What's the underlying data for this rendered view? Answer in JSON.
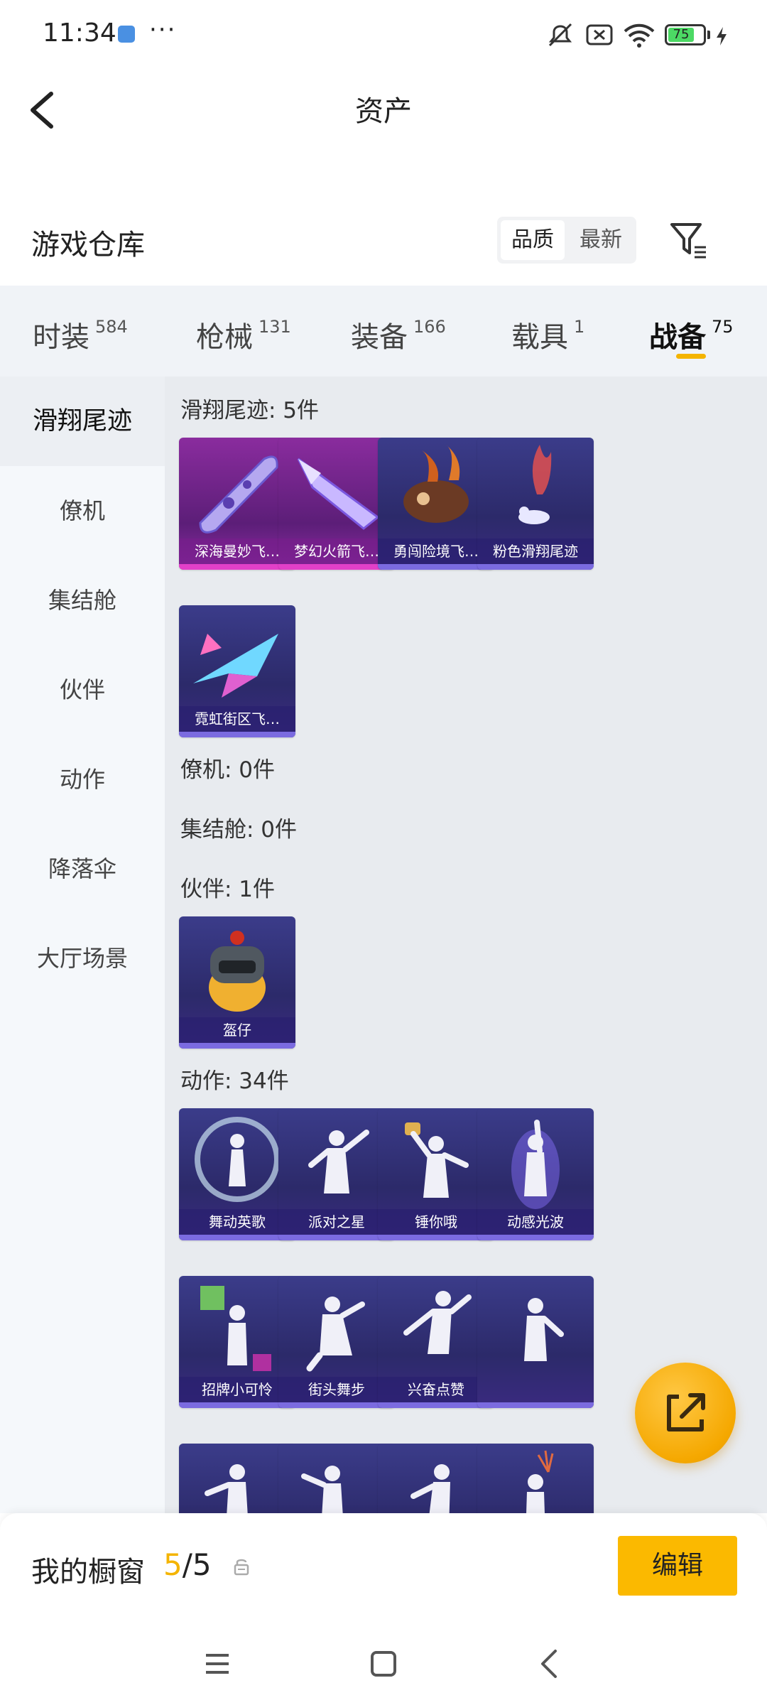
{
  "status_bar": {
    "time": "11:34",
    "dots": "···",
    "battery": "75",
    "icons": [
      "app-notification-icon",
      "mute-icon",
      "sim-off-icon",
      "wifi-icon",
      "battery-icon",
      "charging-icon"
    ]
  },
  "header": {
    "title": "资产"
  },
  "warehouse": {
    "title": "游戏仓库",
    "sort_quality": "品质",
    "sort_newest": "最新"
  },
  "tabs": [
    {
      "label": "时装",
      "count": "584"
    },
    {
      "label": "枪械",
      "count": "131"
    },
    {
      "label": "装备",
      "count": "166"
    },
    {
      "label": "载具",
      "count": "1"
    },
    {
      "label": "战备",
      "count": "75"
    }
  ],
  "sidebar": {
    "items": [
      "滑翔尾迹",
      "僚机",
      "集结舱",
      "伙伴",
      "动作",
      "降落伞",
      "大厅场景"
    ]
  },
  "groups": {
    "trail": {
      "header": "滑翔尾迹: 5件",
      "items": [
        "深海曼妙飞…",
        "梦幻火箭飞…",
        "勇闯险境飞…",
        "粉色滑翔尾迹",
        "霓虹街区飞…"
      ]
    },
    "wingman": {
      "header": "僚机: 0件"
    },
    "capsule": {
      "header": "集结舱: 0件"
    },
    "partner": {
      "header": "伙伴: 1件",
      "items": [
        "盔仔"
      ]
    },
    "emote": {
      "header": "动作: 34件",
      "items": [
        "舞动英歌",
        "派对之星",
        "锤你哦",
        "动感光波",
        "招牌小可怜",
        "街头舞步",
        "兴奋点赞"
      ]
    }
  },
  "showcase": {
    "label": "我的橱窗",
    "current": "5",
    "total": "/5",
    "edit": "编辑"
  },
  "colors": {
    "accent": "#f4b400",
    "edit_button": "#fbb900",
    "tab_bg": "#f0f3f7",
    "content_bg": "#e8ebef",
    "card_purple": "#2c2a6a",
    "card_pink": "#8a2c9e"
  }
}
